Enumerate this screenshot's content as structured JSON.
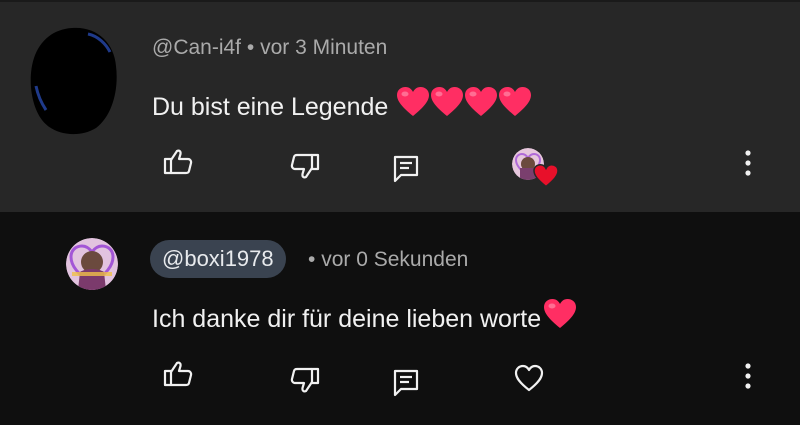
{
  "comments": [
    {
      "author": "@Can-i4f",
      "separator": "•",
      "time": "vor 3 Minuten",
      "text": "Du bist eine Legende",
      "emoji": "❤️❤️❤️❤️"
    },
    {
      "author": "@boxi1978",
      "separator": "•",
      "time": "vor 0 Sekunden",
      "text": "Ich danke dir für deine lieben worte",
      "emoji": "❤️"
    }
  ],
  "icons": {
    "like": "thumbs-up-icon",
    "dislike": "thumbs-down-icon",
    "reply": "reply-icon",
    "heart": "heart-outline-icon",
    "more": "more-vert-icon"
  },
  "colors": {
    "background_top": "#272727",
    "background_bottom": "#0f0f0f",
    "meta_text": "#aaaaaa",
    "heart_red": "#ff2e63",
    "chip": "#3a4350"
  }
}
